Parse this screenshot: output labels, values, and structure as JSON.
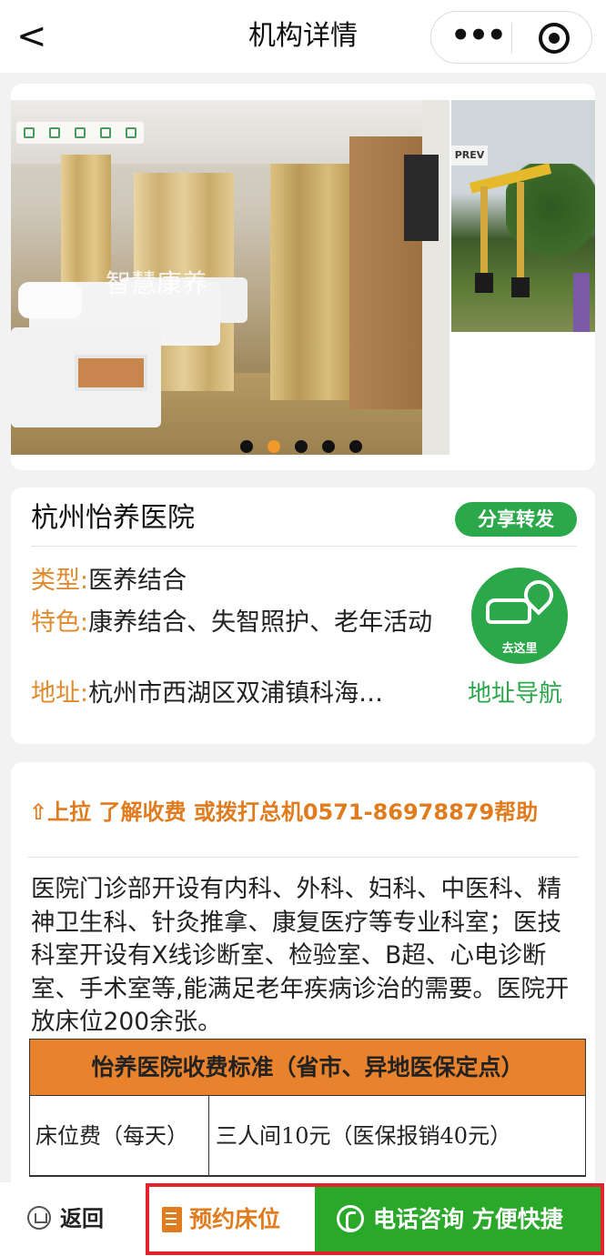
{
  "nav": {
    "back_symbol": "<",
    "title": "机构详情",
    "more_symbol": "•••"
  },
  "carousel": {
    "watermark": "智慧康养",
    "side_tag": "PREV",
    "slide_count": 5,
    "active_index": 1,
    "active_color": "#f09a2c"
  },
  "institution": {
    "name": "杭州怡养医院",
    "share_label": "分享转发",
    "type_key": "类型:",
    "type_value": "医养结合",
    "feature_key": "特色:",
    "feature_value": "康养结合、失智照护、老年活动",
    "address_key": "地址:",
    "address_value": "杭州市西湖区双浦镇科海…",
    "go_label": "去这里",
    "nav_link": "地址导航"
  },
  "detail": {
    "pull_tip": "⇧上拉 了解收费 或拨打总机0571-86978879帮助",
    "description": "医院门诊部开设有内科、外科、妇科、中医科、精神卫生科、针灸推拿、康复医疗等专业科室；医技科室开设有X线诊断室、检验室、B超、心电诊断室、手术室等,能满足老年疾病诊治的需要。医院开放床位200余张。",
    "fee_table": {
      "title": "怡养医院收费标准（省市、异地医保定点）",
      "rows": [
        {
          "item": "床位费（每天）",
          "price": "三人间10元（医保报销40元）"
        }
      ]
    }
  },
  "bottom_bar": {
    "home_label": "返回",
    "book_label": "预约床位",
    "call_label": "电话咨询 方便快捷"
  },
  "colors": {
    "brand_green": "#2aa84a",
    "accent_orange": "#e08a2e",
    "table_header": "#e9822c",
    "highlight_red": "#e3222b"
  }
}
